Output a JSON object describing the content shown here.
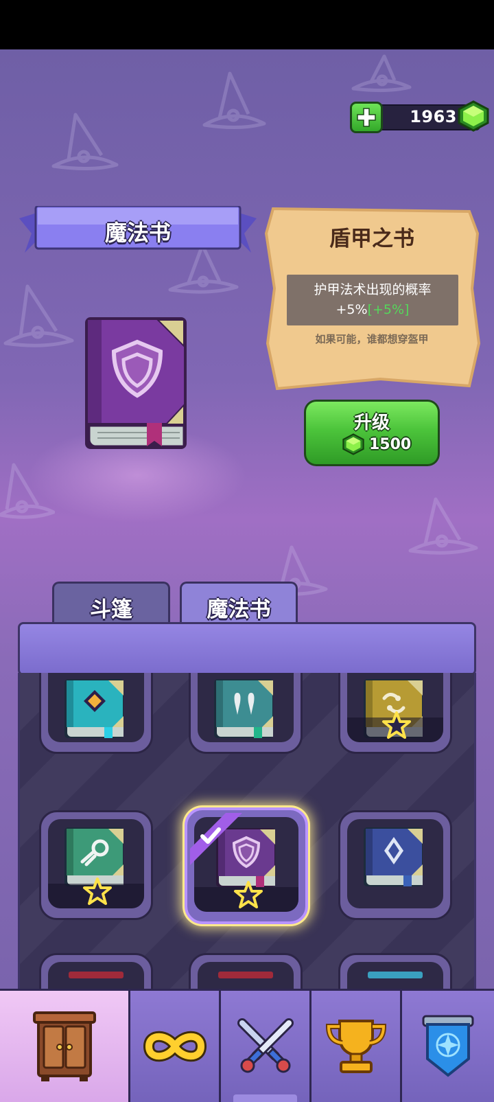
{
  "currency": {
    "amount": "1963",
    "add_icon": "plus-icon",
    "gem_icon": "green-gem-icon"
  },
  "banner": {
    "title": "魔法书"
  },
  "selected_item": {
    "icon": "shield-spellbook",
    "name": "盾甲之书",
    "effect_line1": "护甲法术出现的概率",
    "effect_value": "+5%",
    "effect_bonus": "[+5%]",
    "flavor": "如果可能，谁都想穿盔甲"
  },
  "upgrade": {
    "label": "升级",
    "cost": "1500",
    "cost_icon": "green-gem-icon"
  },
  "tabs": [
    {
      "label": "斗篷",
      "active": false
    },
    {
      "label": "魔法书",
      "active": true
    }
  ],
  "books": [
    {
      "name": "diamond-spellbook",
      "color": "#2ab3be",
      "starred": false,
      "selected": false
    },
    {
      "name": "fang-spellbook",
      "color": "#3d8d92",
      "starred": false,
      "selected": false
    },
    {
      "name": "swirl-spellbook",
      "color": "#b79b34",
      "starred": true,
      "selected": false
    },
    {
      "name": "comet-spellbook",
      "color": "#3d9a78",
      "starred": true,
      "selected": false
    },
    {
      "name": "shield-spellbook",
      "color": "#6a3a8f",
      "starred": true,
      "selected": true
    },
    {
      "name": "crystal-spellbook",
      "color": "#3b4f9e",
      "starred": false,
      "selected": false
    }
  ],
  "nav": [
    {
      "name": "wardrobe",
      "icon": "wardrobe-icon",
      "active": true
    },
    {
      "name": "endless",
      "icon": "infinity-icon",
      "active": false
    },
    {
      "name": "battle",
      "icon": "crossed-swords-icon",
      "active": false
    },
    {
      "name": "trophies",
      "icon": "trophy-icon",
      "active": false
    },
    {
      "name": "guild",
      "icon": "banner-shield-icon",
      "active": false
    }
  ],
  "colors": {
    "background": "#7a64ad",
    "accent_green": "#4cc43b",
    "bonus_text": "#55d85b",
    "highlight": "#ffe88a"
  }
}
